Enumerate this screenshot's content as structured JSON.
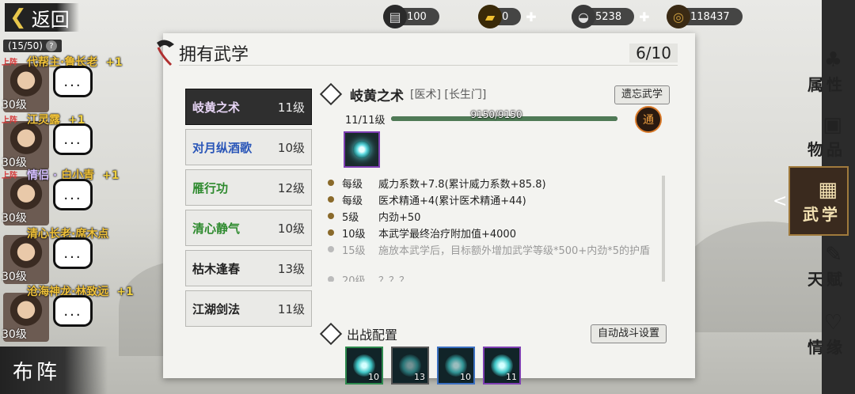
{
  "nav": {
    "back_label": "返回",
    "formation_label": "布阵"
  },
  "party": {
    "count": "(15/50)",
    "help": "?",
    "members": [
      {
        "deploy": "上阵",
        "name": "代帮主·鲁长老",
        "tag": "",
        "bonus": "+1",
        "level": "30级"
      },
      {
        "deploy": "上阵",
        "name": "江灵露",
        "tag": "",
        "bonus": "+1",
        "level": "30级"
      },
      {
        "deploy": "上阵",
        "name": "白小青",
        "tag": "情侣 · ",
        "bonus": "+1",
        "level": "30级"
      },
      {
        "deploy": "",
        "name": "清心长老·席木点",
        "tag": "",
        "bonus": "",
        "level": "30级"
      },
      {
        "deploy": "",
        "name": "沧海神龙·林致远",
        "tag": "",
        "bonus": "+1",
        "level": "30级"
      }
    ],
    "chat_icon_text": "..."
  },
  "resources": [
    {
      "icon": "cart-icon",
      "value": "100",
      "plus": false
    },
    {
      "icon": "gold-bar-icon",
      "value": "0",
      "plus": true
    },
    {
      "icon": "silver-ingot-icon",
      "value": "5238",
      "plus": true
    },
    {
      "icon": "copper-coin-icon",
      "value": "118437",
      "plus": false
    }
  ],
  "tabs": [
    {
      "label": "属性",
      "icon": "gourd-icon",
      "active": false
    },
    {
      "label": "物品",
      "icon": "bag-icon",
      "active": false
    },
    {
      "label": "武学",
      "icon": "book-icon",
      "active": true
    },
    {
      "label": "天赋",
      "icon": "brush-icon",
      "active": false
    },
    {
      "label": "情缘",
      "icon": "heart-icon",
      "active": false
    }
  ],
  "panel": {
    "title": "拥有武学",
    "count": "6/10"
  },
  "skills": [
    {
      "name": "岐黄之术",
      "level": "11级",
      "color": "purple",
      "selected": true
    },
    {
      "name": "对月纵酒歌",
      "level": "10级",
      "color": "blue",
      "selected": false
    },
    {
      "name": "雁行功",
      "level": "12级",
      "color": "green",
      "selected": false
    },
    {
      "name": "清心静气",
      "level": "10级",
      "color": "green",
      "selected": false
    },
    {
      "name": "枯木逢春",
      "level": "13级",
      "color": "dark",
      "selected": false
    },
    {
      "name": "江湖剑法",
      "level": "11级",
      "color": "dark",
      "selected": false
    }
  ],
  "detail": {
    "name": "岐黄之术",
    "tags": "[医术] [长生门]",
    "forget_label": "遗忘武学",
    "level_text": "11/11级",
    "xp_text": "9150/9150",
    "xp_fraction": 1.0,
    "mastery_label": "通",
    "effects": [
      {
        "when": "每级",
        "text": "威力系数+7.8(累计威力系数+85.8)",
        "locked": false
      },
      {
        "when": "每级",
        "text": "医术精通+4(累计医术精通+44)",
        "locked": false
      },
      {
        "when": "5级",
        "text": "内劲+50",
        "locked": false
      },
      {
        "when": "10级",
        "text": "本武学最终治疗附加值+4000",
        "locked": false
      },
      {
        "when": "15级",
        "text": "施放本武学后，目标额外增加武学等级*500+内劲*5的护盾",
        "locked": true
      },
      {
        "when": "20级",
        "text": "？？？",
        "locked": true
      }
    ],
    "combat_title": "出战配置",
    "auto_label": "自动战斗设置",
    "combat_slots": [
      {
        "icon": "green-wave-skill-icon",
        "count": "10",
        "border": "#2e8a4e"
      },
      {
        "icon": "shadow-figure-skill-icon",
        "count": "13",
        "border": "#555555"
      },
      {
        "icon": "moon-wine-skill-icon",
        "count": "10",
        "border": "#3a6fc0"
      },
      {
        "icon": "orb-skill-icon",
        "count": "11",
        "border": "#7e3fb2"
      }
    ]
  },
  "colors": {
    "selected_tab_border": "#a07a3c",
    "skill_purple": "#7a3fb0",
    "skill_blue": "#2a56b8",
    "skill_green": "#2e8a2e"
  }
}
